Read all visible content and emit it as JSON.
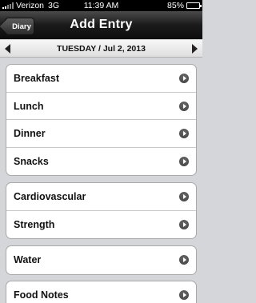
{
  "status_bar": {
    "carrier": "Verizon",
    "network": "3G",
    "time": "11:39 AM",
    "battery": "85%",
    "battery_level": 0.85
  },
  "nav": {
    "back_label": "Diary",
    "title": "Add Entry"
  },
  "date_bar": {
    "date": "TUESDAY / Jul 2, 2013"
  },
  "groups": [
    {
      "items": [
        {
          "label": "Breakfast"
        },
        {
          "label": "Lunch"
        },
        {
          "label": "Dinner"
        },
        {
          "label": "Snacks"
        }
      ]
    },
    {
      "items": [
        {
          "label": "Cardiovascular"
        },
        {
          "label": "Strength"
        }
      ]
    },
    {
      "items": [
        {
          "label": "Water"
        }
      ]
    },
    {
      "items": [
        {
          "label": "Food Notes"
        }
      ]
    }
  ],
  "icons": {
    "chevron": "chevron-right-circle-icon",
    "prev": "prev-arrow-icon",
    "next": "next-arrow-icon"
  }
}
